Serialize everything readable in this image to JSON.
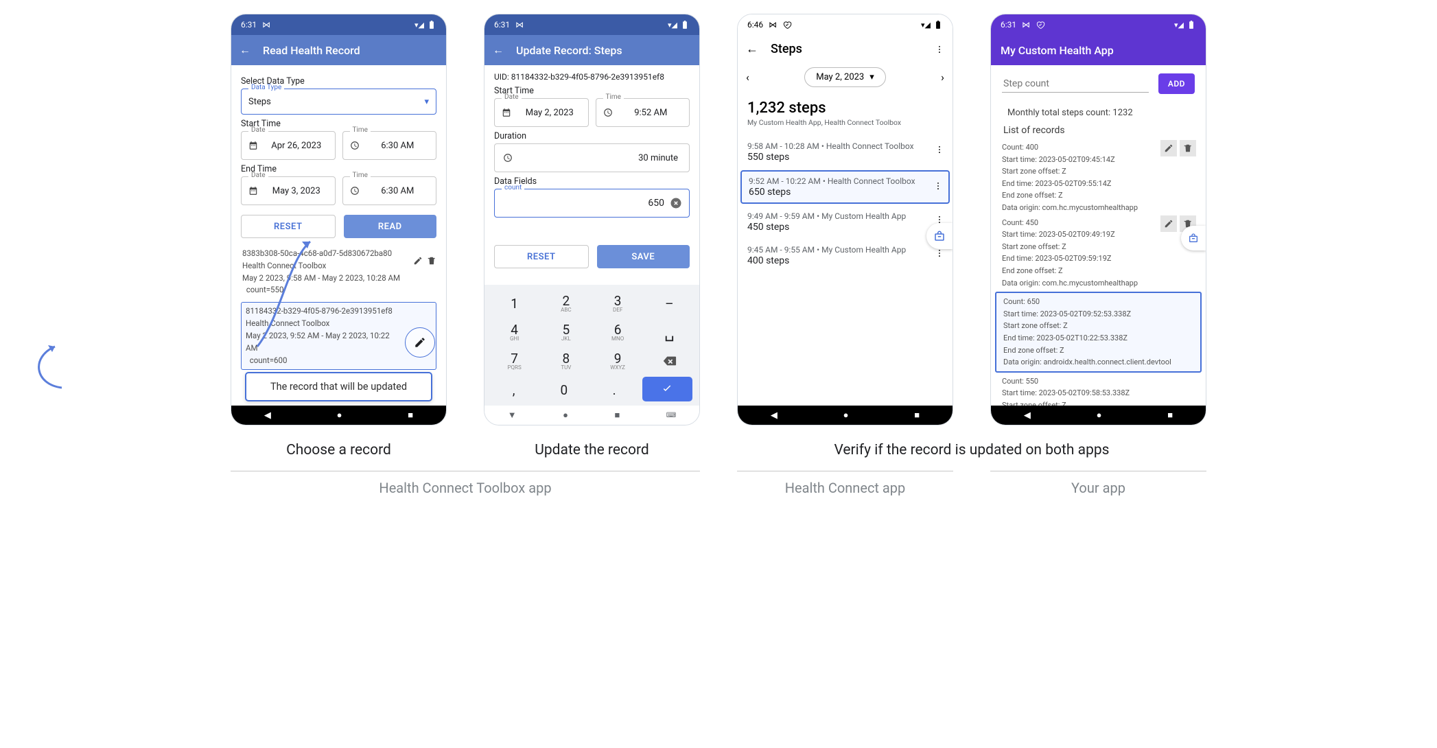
{
  "captions": {
    "c1": "Choose a record",
    "c2": "Update the record",
    "c3": "Verify if the record is updated on both apps",
    "s1": "Health Connect Toolbox  app",
    "s2": "Health Connect app",
    "s3": "Your app"
  },
  "callout": "The record that will be updated",
  "phone1": {
    "time": "6:31",
    "title": "Read Health Record",
    "select_label": "Select Data Type",
    "datatype_legend": "Data Type",
    "datatype": "Steps",
    "start_label": "Start Time",
    "end_label": "End Time",
    "date_legend": "Date",
    "time_legend": "Time",
    "start_date": "Apr 26, 2023",
    "start_time": "6:30 AM",
    "end_date": "May 3, 2023",
    "end_time": "6:30 AM",
    "reset": "RESET",
    "read": "READ",
    "rec1_uid": "8383b308-50ca-4c68-a0d7-5d830672ba80",
    "rec1_src": "Health Connect Toolbox",
    "rec1_range": "May 2 2023, 9:58 AM - May 2 2023, 10:28 AM",
    "rec1_count": "  count=550",
    "rec2_uid": "81184332-b329-4f05-8796-2e3913951ef8",
    "rec2_src": "Health Connect Toolbox",
    "rec2_range": "May 2 2023, 9:52 AM - May 2 2023, 10:22 AM",
    "rec2_count": "  count=600"
  },
  "phone2": {
    "time": "6:31",
    "title": "Update Record: Steps",
    "uid": "UID: 81184332-b329-4f05-8796-2e3913951ef8",
    "start_label": "Start Time",
    "date_legend": "Date",
    "time_legend": "Time",
    "date": "May 2, 2023",
    "timev": "9:52 AM",
    "dur_label": "Duration",
    "dur_val": "30 minute",
    "fields_label": "Data Fields",
    "count_legend": "count",
    "count_val": "650",
    "reset": "RESET",
    "save": "SAVE",
    "keys": [
      "1",
      "2",
      "3",
      "4",
      "5",
      "6",
      "7",
      "8",
      "9",
      "0"
    ],
    "sublabels": {
      "2": "ABC",
      "3": "DEF",
      "4": "GHI",
      "5": "JKL",
      "6": "MNO",
      "7": "PQRS",
      "8": "TUV",
      "9": "WXYZ"
    }
  },
  "phone3": {
    "time": "6:46",
    "title": "Steps",
    "date": "May 2, 2023",
    "total": "1,232 steps",
    "srcs": "My Custom Health App, Health Connect Toolbox",
    "e1_t": "9:58 AM - 10:28 AM • Health Connect Toolbox",
    "e1_v": "550 steps",
    "e2_t": "9:52 AM - 10:22 AM • Health Connect Toolbox",
    "e2_v": "650 steps",
    "e3_t": "9:49 AM - 9:59 AM • My Custom Health App",
    "e3_v": "450 steps",
    "e4_t": "9:45 AM - 9:55 AM • My Custom Health App",
    "e4_v": "400 steps"
  },
  "phone4": {
    "time": "6:31",
    "title": "My Custom Health App",
    "placeholder": "Step count",
    "add": "ADD",
    "total": "Monthly total steps count: 1232",
    "list_label": "List of records",
    "r1": [
      "Count: 400",
      "Start time: 2023-05-02T09:45:14Z",
      "Start zone offset: Z",
      "End time: 2023-05-02T09:55:14Z",
      "End zone offset: Z",
      "Data origin: com.hc.mycustomhealthapp"
    ],
    "r2": [
      "Count: 450",
      "Start time: 2023-05-02T09:49:19Z",
      "Start zone offset: Z",
      "End time: 2023-05-02T09:59:19Z",
      "End zone offset: Z",
      "Data origin: com.hc.mycustomhealthapp"
    ],
    "r3": [
      "Count: 650",
      "Start time: 2023-05-02T09:52:53.338Z",
      "Start zone offset: Z",
      "End time: 2023-05-02T10:22:53.338Z",
      "End zone offset: Z",
      "Data origin: androidx.health.connect.client.devtool"
    ],
    "r4": [
      "Count: 550",
      "Start time: 2023-05-02T09:58:53.338Z",
      "Start zone offset: Z"
    ]
  }
}
